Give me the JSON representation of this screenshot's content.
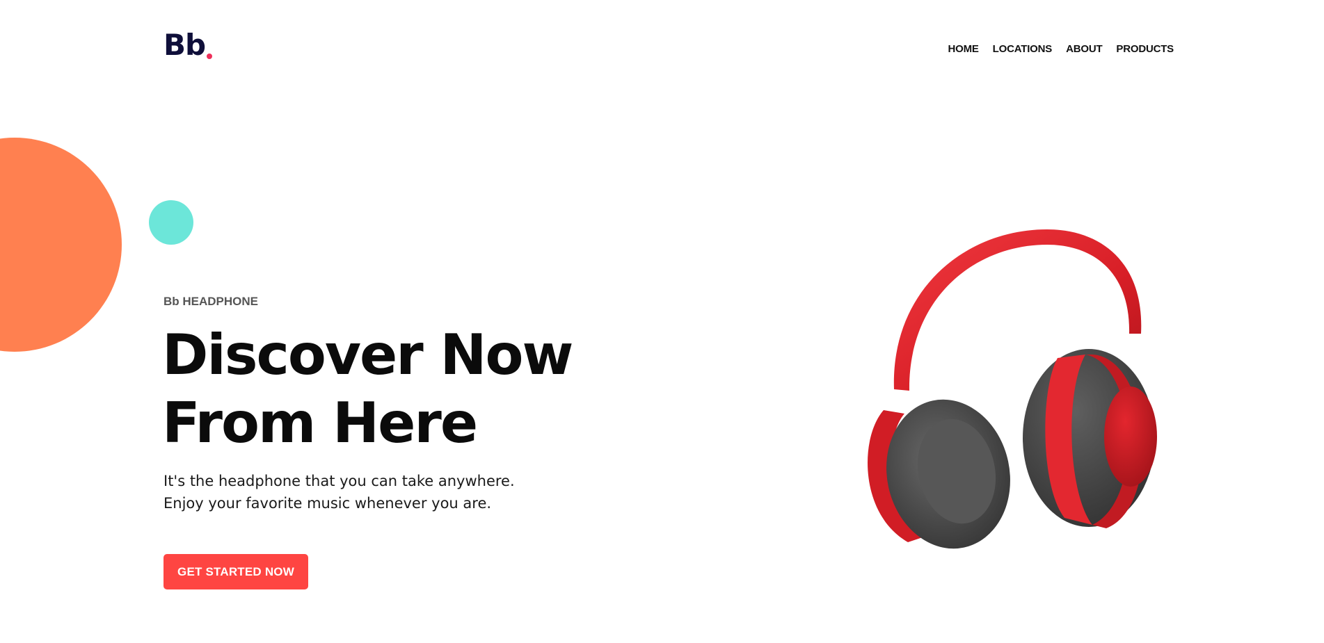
{
  "header": {
    "logo_text": "Bb",
    "nav": [
      {
        "label": "HOME"
      },
      {
        "label": "LOCATIONS"
      },
      {
        "label": "ABOUT"
      },
      {
        "label": "PRODUCTS"
      }
    ]
  },
  "hero": {
    "eyebrow": "Bb HEADPHONE",
    "headline_line1": "Discover Now",
    "headline_line2": "From Here",
    "description_line1": "It's the headphone that you can take anywhere.",
    "description_line2": "Enjoy your favorite music whenever you are.",
    "cta_label": "GET STARTED NOW",
    "image_icon": "headphones-illustration"
  },
  "colors": {
    "brand_navy": "#0f0f3a",
    "logo_dot": "#ee2f5a",
    "accent_red": "#fe4542",
    "decor_orange": "#ff8050",
    "decor_teal": "#6ce6d9",
    "headphone_red": "#e0232b",
    "headphone_gray": "#4a4a4a"
  }
}
